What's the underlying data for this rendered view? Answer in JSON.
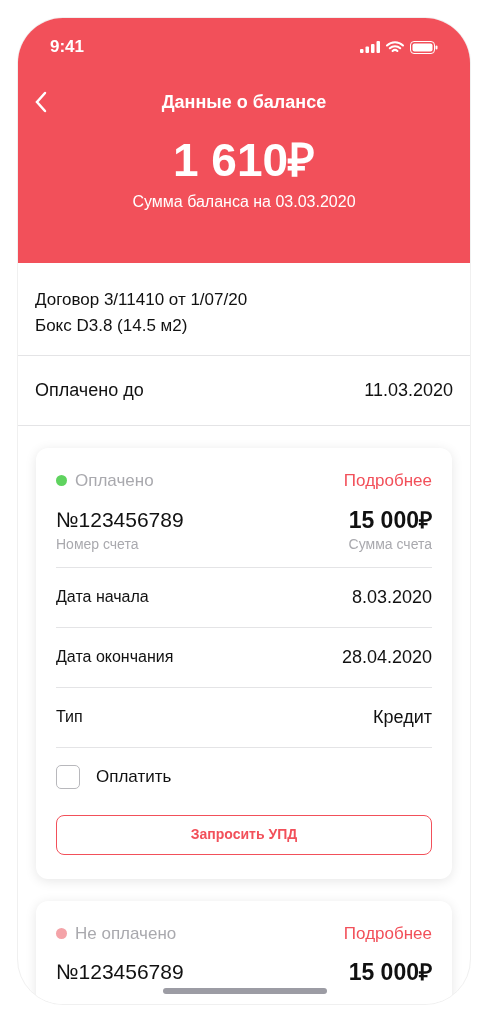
{
  "status_bar": {
    "time": "9:41"
  },
  "header": {
    "title": "Данные о балансе",
    "amount": "1 610₽",
    "caption": "Сумма баланса на 03.03.2020"
  },
  "contract": {
    "lines": [
      "Договор 3/11410 от 1/07/20",
      "Бокс D3.8 (14.5 м2)"
    ]
  },
  "paid_until": {
    "label": "Оплачено до",
    "value": "11.03.2020"
  },
  "invoices": [
    {
      "status": "Оплачено",
      "color": "#5fd35f",
      "details_link": "Подробнее",
      "number": "№123456789",
      "number_label": "Номер счета",
      "amount": "15 000₽",
      "amount_label": "Сумма счета",
      "rows": [
        {
          "label": "Дата начала",
          "value": "8.03.2020"
        },
        {
          "label": "Дата окончания",
          "value": "28.04.2020"
        },
        {
          "label": "Тип",
          "value": "Кредит"
        }
      ],
      "pay_checkbox": {
        "label": "Оплатить",
        "checked": false
      },
      "button": "Запросить УПД"
    },
    {
      "status": "Не оплачено",
      "color": "#f4a3a8",
      "details_link": "Подробнее",
      "number": "№123456789",
      "amount": "15 000₽"
    }
  ]
}
